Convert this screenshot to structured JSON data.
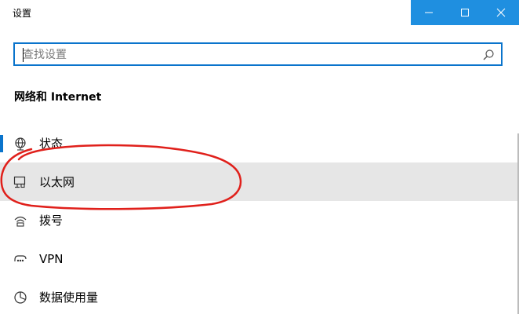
{
  "window": {
    "title": "设置"
  },
  "search": {
    "placeholder": "查找设置"
  },
  "section": {
    "title": "网络和 Internet"
  },
  "nav": {
    "items": [
      {
        "label": "状态",
        "icon": "globe-icon"
      },
      {
        "label": "以太网",
        "icon": "ethernet-icon"
      },
      {
        "label": "拨号",
        "icon": "dialup-icon"
      },
      {
        "label": "VPN",
        "icon": "vpn-icon"
      },
      {
        "label": "数据使用量",
        "icon": "data-usage-icon"
      }
    ]
  },
  "colors": {
    "accent": "#0a74cc",
    "title_controls_bg": "#1f8fe0",
    "hover_bg": "#e6e6e6",
    "annotation": "#e0201b"
  }
}
